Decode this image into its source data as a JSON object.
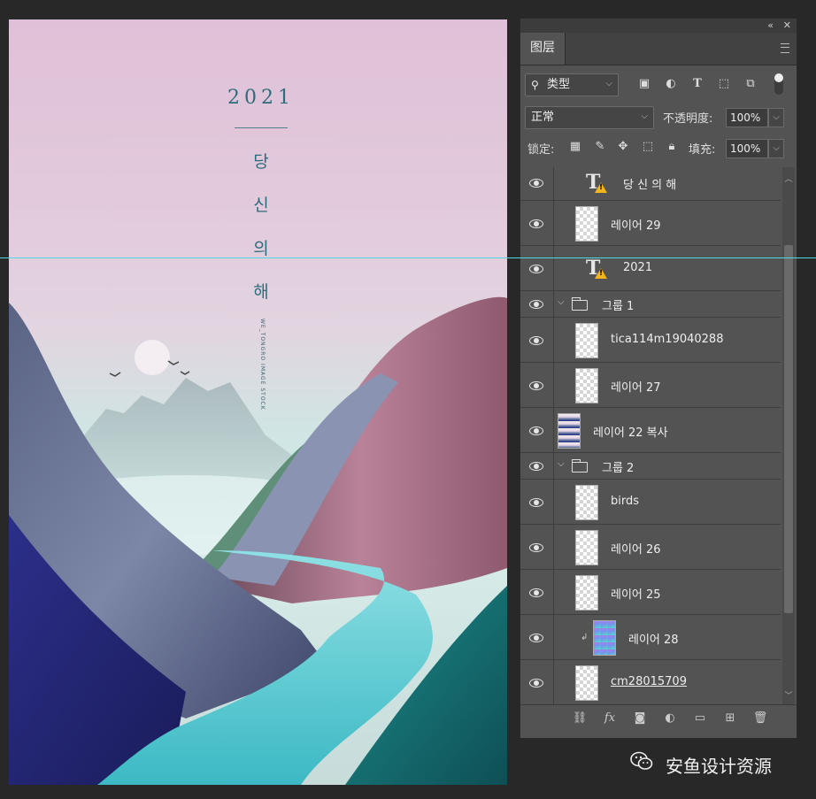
{
  "poster": {
    "year": "2021",
    "title_chars": [
      "당",
      "신",
      "의",
      "해"
    ],
    "credit": "WE_TONGRO IMAGE STOCK"
  },
  "panel": {
    "tab": "图层",
    "filter": {
      "label": "类型",
      "icon": "search-icon"
    },
    "blend_mode": "正常",
    "opacity_label": "不透明度:",
    "opacity_value": "100%",
    "lock_label": "锁定:",
    "fill_label": "填充:",
    "fill_value": "100%",
    "layers": [
      {
        "name": "당 신 의 해",
        "kind": "text",
        "warning": true,
        "indent": 1
      },
      {
        "name": "레이어 29",
        "kind": "pixel",
        "indent": 1
      },
      {
        "name": "2021",
        "kind": "text",
        "warning": true,
        "indent": 1
      },
      {
        "name": "그룹 1",
        "kind": "group",
        "indent": 0
      },
      {
        "name": "tica114m19040288",
        "kind": "pixel",
        "indent": 1
      },
      {
        "name": "레이어 27",
        "kind": "pixel",
        "indent": 1
      },
      {
        "name": "레이어 22 복사",
        "kind": "pixel",
        "indent": 0
      },
      {
        "name": "그룹 2",
        "kind": "group",
        "indent": 0
      },
      {
        "name": "birds",
        "kind": "pixel",
        "indent": 1
      },
      {
        "name": "레이어 26",
        "kind": "pixel",
        "indent": 1
      },
      {
        "name": "레이어 25",
        "kind": "pixel",
        "indent": 1
      },
      {
        "name": "레이어 28",
        "kind": "clipped",
        "indent": 1
      },
      {
        "name": "cm28015709",
        "kind": "pixel",
        "indent": 1
      }
    ],
    "bottom_icons": [
      "link-icon",
      "fx-icon",
      "mask-icon",
      "adjustment-icon",
      "folder-icon",
      "new-layer-icon",
      "trash-icon"
    ]
  },
  "watermark": {
    "text": "安鱼设计资源",
    "icon": "wechat-icon"
  },
  "colors": {
    "guide": "#4fd6e0",
    "panel_bg": "#535353",
    "accent_text": "#2e6b7b"
  }
}
